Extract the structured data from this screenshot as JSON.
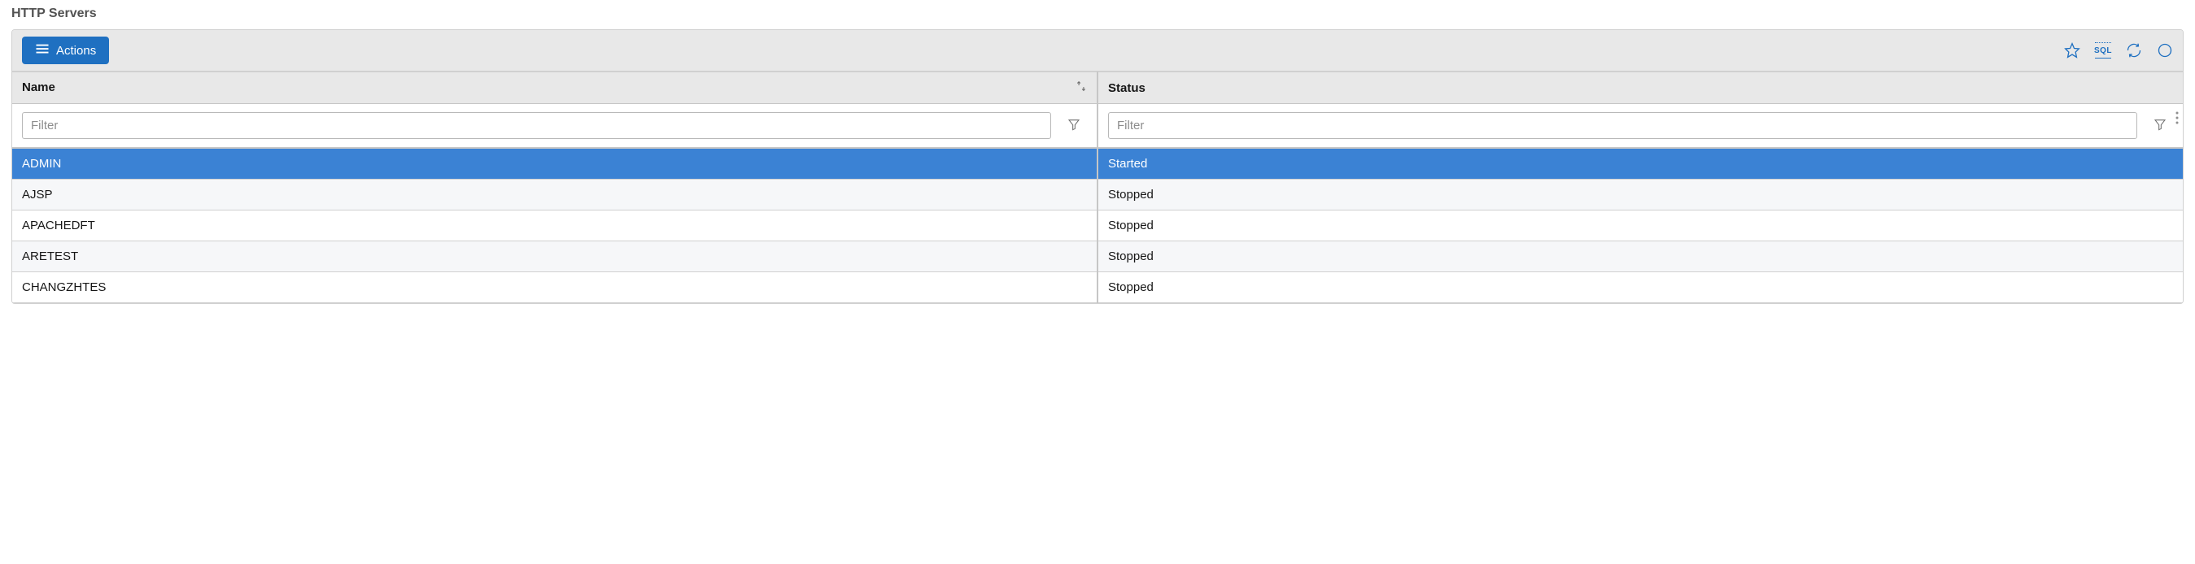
{
  "page": {
    "title": "HTTP Servers"
  },
  "toolbar": {
    "actions_label": "Actions"
  },
  "columns": {
    "name": {
      "header": "Name",
      "filter_placeholder": "Filter"
    },
    "status": {
      "header": "Status",
      "filter_placeholder": "Filter"
    }
  },
  "rows": [
    {
      "name": "ADMIN",
      "status": "Started",
      "selected": true
    },
    {
      "name": "AJSP",
      "status": "Stopped",
      "selected": false
    },
    {
      "name": "APACHEDFT",
      "status": "Stopped",
      "selected": false
    },
    {
      "name": "ARETEST",
      "status": "Stopped",
      "selected": false
    },
    {
      "name": "CHANGZHTES",
      "status": "Stopped",
      "selected": false
    }
  ],
  "icons": {
    "favorite": "favorite",
    "sql": "SQL",
    "refresh": "refresh",
    "reset": "reset"
  }
}
